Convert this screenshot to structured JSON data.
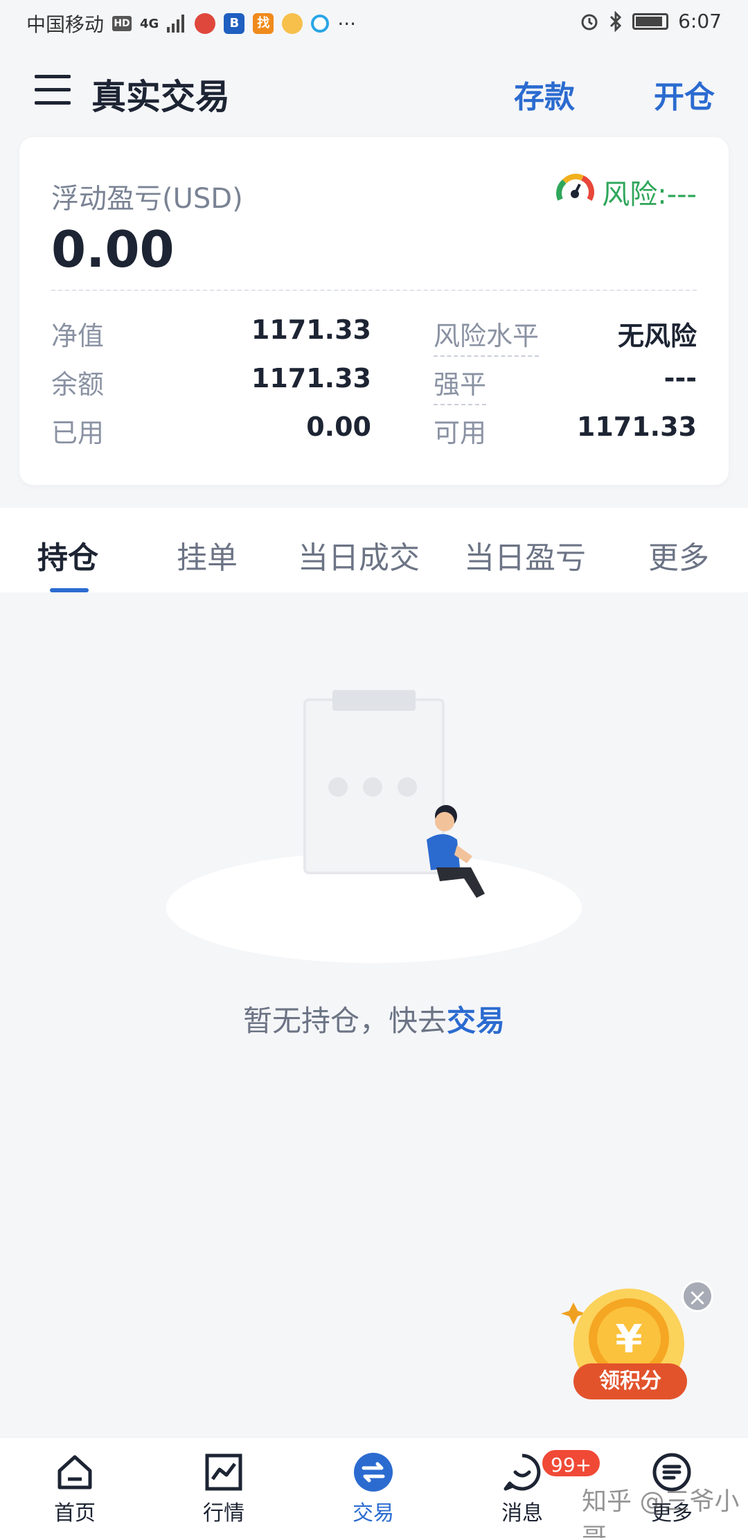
{
  "status_bar": {
    "carrier": "中国移动",
    "hd": "HD",
    "network": "4G",
    "more": "···",
    "time": "6:07",
    "apps": [
      {
        "icon": "app-icon-red",
        "color": "#e0473c"
      },
      {
        "icon": "app-icon-blue-b",
        "label": "B",
        "color": "#1f5fc0"
      },
      {
        "icon": "app-icon-orange",
        "label": "找",
        "color": "#f08a1c"
      },
      {
        "icon": "weibo-icon",
        "color": "#e6352b"
      },
      {
        "icon": "app-icon-cyan",
        "color": "#2aa6e6"
      }
    ]
  },
  "header": {
    "title": "真实交易",
    "deposit_label": "存款",
    "open_position_label": "开仓"
  },
  "summary": {
    "floating_pl_label": "浮动盈亏(USD)",
    "floating_pl_value": "0.00",
    "risk_label": "风险:---",
    "rows": [
      {
        "k1": "净值",
        "v1": "1171.33",
        "k2": "风险水平",
        "v2": "无风险"
      },
      {
        "k1": "余额",
        "v1": "1171.33",
        "k2": "强平",
        "v2": "---"
      },
      {
        "k1": "已用",
        "v1": "0.00",
        "k2": "可用",
        "v2": "1171.33"
      }
    ]
  },
  "tabs": [
    "持仓",
    "挂单",
    "当日成交",
    "当日盈亏",
    "更多"
  ],
  "empty_state": {
    "text": "暂无持仓，快去",
    "link": "交易"
  },
  "promo": {
    "label": "领积分",
    "coin_symbol": "¥"
  },
  "bottom_nav": [
    {
      "label": "首页",
      "icon": "home-icon"
    },
    {
      "label": "行情",
      "icon": "chart-icon"
    },
    {
      "label": "交易",
      "icon": "exchange-icon"
    },
    {
      "label": "消息",
      "icon": "message-icon"
    },
    {
      "label": "更多",
      "icon": "more-icon"
    }
  ],
  "message_badge": "99+",
  "watermark": "知乎 @三爷小哥",
  "colors": {
    "accent": "#2b6bd0",
    "risk_green": "#2fa65a",
    "badge_red": "#f04a36",
    "text_dark": "#1d2433"
  }
}
